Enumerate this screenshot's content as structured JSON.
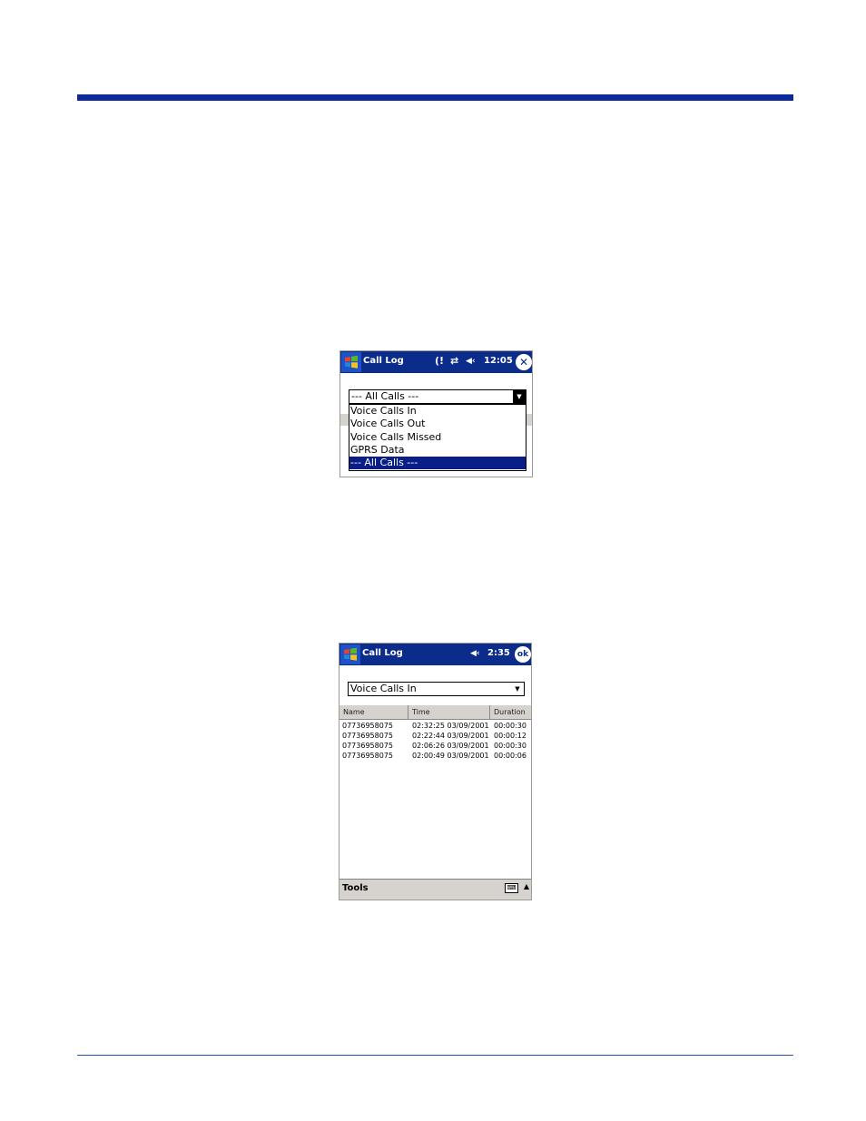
{
  "screen1": {
    "title": "Call Log",
    "status_icons": [
      "(!",
      "⇄",
      "◀‹"
    ],
    "time": "12:05",
    "close_label": "✕",
    "filter_value": "--- All Calls ---",
    "options": [
      "Voice Calls In",
      "Voice Calls Out",
      "Voice Calls Missed",
      "GPRS Data",
      "--- All Calls ---"
    ],
    "selected_option": "--- All Calls ---"
  },
  "screen2": {
    "title": "Call Log",
    "volume_icon": "◀‹",
    "time": "2:35",
    "ok_label": "ok",
    "filter_value": "Voice Calls In",
    "columns": [
      "Name",
      "Time",
      "Duration"
    ],
    "rows": [
      [
        "07736958075",
        "02:32:25 03/09/2001",
        "00:00:30"
      ],
      [
        "07736958075",
        "02:22:44 03/09/2001",
        "00:00:12"
      ],
      [
        "07736958075",
        "02:06:26 03/09/2001",
        "00:00:30"
      ],
      [
        "07736958075",
        "02:00:49 03/09/2001",
        "00:00:06"
      ]
    ],
    "menu": {
      "tools": "Tools"
    }
  },
  "colors": {
    "rule": "#0c2a9c",
    "titlebar": "#0c2c8c",
    "selection": "#0a1e8a",
    "gray": "#d6d3ce"
  }
}
